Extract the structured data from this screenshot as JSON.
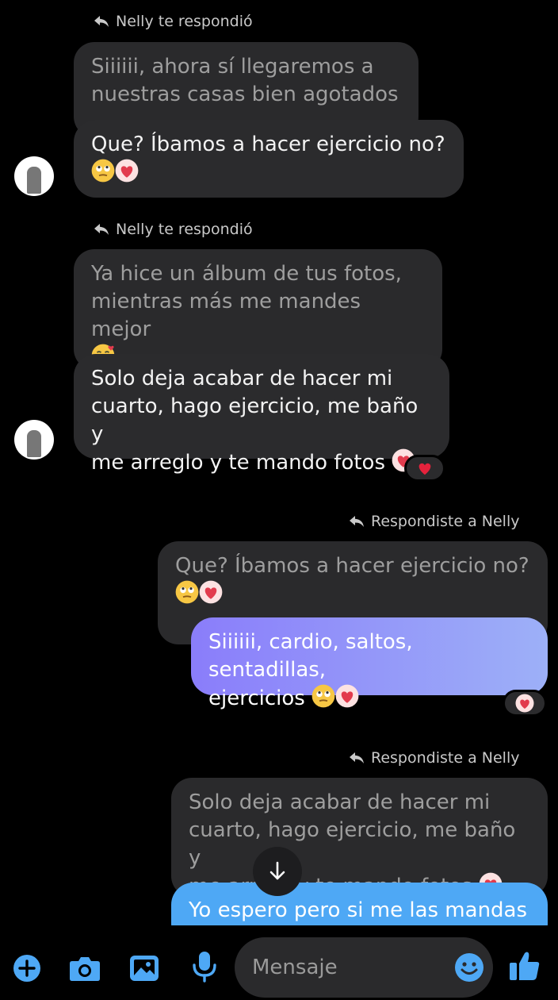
{
  "thread": {
    "reply_notes": {
      "nelly_1": "Nelly te respondió",
      "nelly_2": "Nelly te respondió",
      "you_1": "Respondiste a Nelly",
      "you_2": "Respondiste a Nelly"
    },
    "group1": {
      "quoted": [
        "Siiiiii, ahora sí llegaremos a",
        "nuestras casas bien agotados"
      ],
      "message": [
        "Que? Íbamos a hacer ejercicio no?"
      ]
    },
    "group2": {
      "quoted": [
        "Ya hice un álbum de tus fotos,",
        "mientras más me mandes mejor"
      ],
      "message": [
        "Solo deja acabar de hacer mi",
        "cuarto, hago ejercicio, me baño y",
        "me arreglo y te mando fotos"
      ]
    },
    "group3": {
      "quoted": [
        "Que? Íbamos a hacer ejercicio no?"
      ],
      "message": [
        "Siiiiii, cardio, saltos, sentadillas,",
        "ejercicios"
      ]
    },
    "group4": {
      "quoted": [
        "Solo deja acabar de hacer mi",
        "cuarto, hago ejercicio, me baño y",
        "me arr",
        "y te mando fotos"
      ],
      "message": [
        "Yo espero pero si me las mandas"
      ]
    }
  },
  "composer": {
    "placeholder": "Mensaje"
  },
  "icons": {
    "add": "plus-circle-icon",
    "camera": "camera-icon",
    "gallery": "image-icon",
    "mic": "microphone-icon",
    "emoji": "smiley-icon",
    "like": "thumbs-up-icon",
    "scroll": "arrow-down-icon"
  },
  "colors": {
    "accent": "#4ea8f5",
    "outgoing_gradient_start": "#8a7dfa",
    "outgoing_gradient_end": "#9db0f8"
  }
}
